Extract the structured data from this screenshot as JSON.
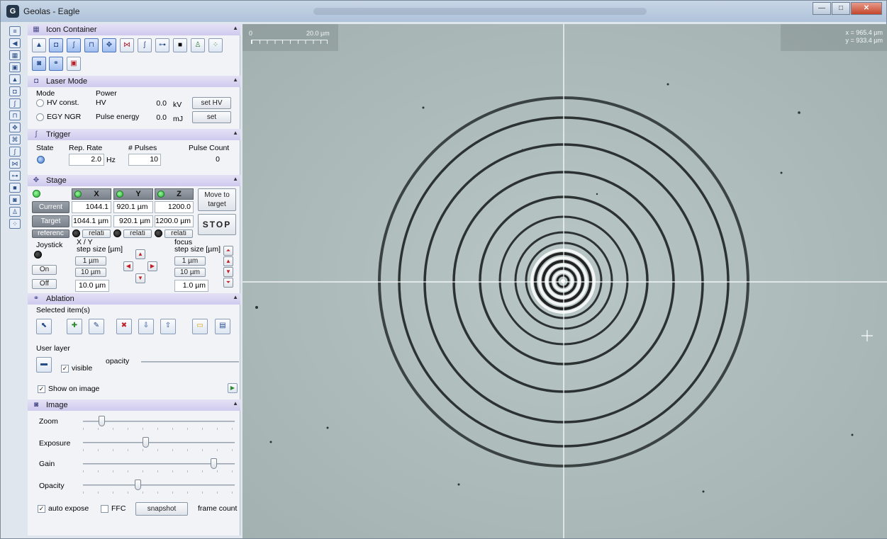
{
  "window": {
    "title": "Geolas - Eagle",
    "app_icon": "G"
  },
  "icon_container": {
    "title": "Icon Container"
  },
  "laser_mode": {
    "title": "Laser Mode",
    "mode_label": "Mode",
    "power_label": "Power",
    "hv_const": "HV const.",
    "egy_ngr": "EGY NGR",
    "hv_label": "HV",
    "hv_value": "0.0",
    "hv_unit": "kV",
    "set_hv": "set HV",
    "pulse_energy_label": "Pulse energy",
    "pulse_energy_value": "0.0",
    "pulse_energy_unit": "mJ",
    "set": "set"
  },
  "trigger": {
    "title": "Trigger",
    "state_label": "State",
    "rep_rate_label": "Rep. Rate",
    "rep_rate_value": "2.0",
    "rep_rate_unit": "Hz",
    "pulses_label": "# Pulses",
    "pulses_value": "10",
    "pulse_count_label": "Pulse Count",
    "pulse_count_value": "0"
  },
  "stage": {
    "title": "Stage",
    "x": "X",
    "y": "Y",
    "z": "Z",
    "current": "Current",
    "target": "Target",
    "reference": "referenc",
    "relati": "relati",
    "relati_y": "relati",
    "relati_z": "relati",
    "current_x": "1044.1",
    "current_y": "920.1 µm",
    "current_z": "1200.0",
    "target_x": "1044.1 µm",
    "target_y": "920.1 µm",
    "target_z": "1200.0 µm",
    "move_to_target": "Move to target",
    "stop": "STOP",
    "joystick_label": "Joystick",
    "xy_label": "X / Y",
    "xy_step_label": "step size [µm]",
    "focus_label": "focus",
    "focus_step_label": "step size [µm]",
    "on": "On",
    "off": "Off",
    "xy_1um": "1 µm",
    "xy_10um": "10 µm",
    "xy_step_value": "10.0 µm",
    "f_1um": "1 µm",
    "f_10um": "10 µm",
    "f_step_value": "1.0 µm"
  },
  "ablation": {
    "title": "Ablation",
    "selected_items": "Selected item(s)",
    "user_layer": "User layer",
    "visible": "visible",
    "opacity": "opacity",
    "show_on_image": "Show on image"
  },
  "image": {
    "title": "Image",
    "zoom": "Zoom",
    "exposure": "Exposure",
    "gain": "Gain",
    "opacity": "Opacity",
    "auto_expose": "auto expose",
    "ffc": "FFC",
    "snapshot": "snapshot",
    "frame_count": "frame count",
    "zoom_level": 0.12,
    "exposure_level": 0.41,
    "gain_level": 0.86,
    "opacity_level": 0.36
  },
  "viewer": {
    "scale_zero": "0",
    "scale_len": "20.0 µm",
    "coord_x": "x = 965.4 µm",
    "coord_y": "y = 933.4 µm"
  }
}
